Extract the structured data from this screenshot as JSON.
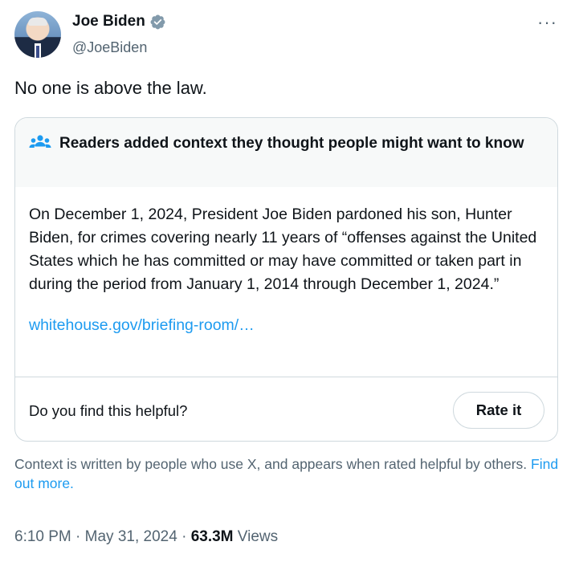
{
  "author": {
    "name": "Joe Biden",
    "handle": "@JoeBiden",
    "verified_badge": "verified-badge-icon"
  },
  "more_menu": "···",
  "tweet": {
    "text": "No one is above the law."
  },
  "community_note": {
    "title": "Readers added context they thought people might want to know",
    "body": "On December 1, 2024, President Joe Biden pardoned his son, Hunter Biden, for crimes covering nearly 11 years of “offenses against the United States which he has committed or may have committed or taken part in during the period from January 1, 2014 through December 1, 2024.”",
    "link": "whitehouse.gov/briefing-room/…",
    "helpful_prompt": "Do you find this helpful?",
    "rate_button": "Rate it"
  },
  "context_disclaimer": {
    "text": "Context is written by people who use X, and appears when rated helpful by others.",
    "link": "Find out more."
  },
  "meta": {
    "time": "6:10 PM",
    "date": "May 31, 2024",
    "views_count": "63.3M",
    "views_label": "Views",
    "separator": "·"
  },
  "colors": {
    "text": "#0f1419",
    "secondary": "#536471",
    "link": "#1d9bf0",
    "border": "#cfd9de",
    "note_header_bg": "#f7f9f9"
  }
}
